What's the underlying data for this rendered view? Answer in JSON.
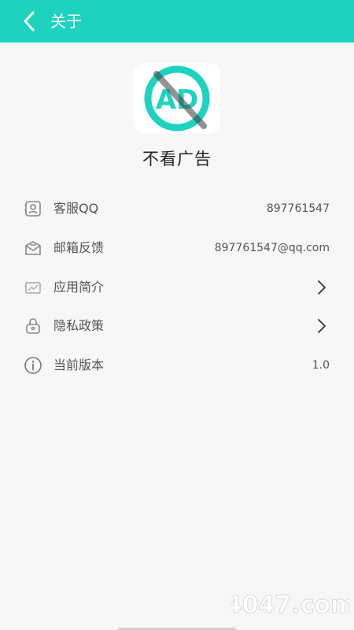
{
  "header": {
    "title": "关于",
    "back_icon": "chevron-left-icon"
  },
  "app": {
    "name": "不看广告",
    "icon_text": "AD",
    "icon_color": "#1dd3c0"
  },
  "rows": [
    {
      "icon": "contact-card-icon",
      "label": "客服QQ",
      "value": "897761547"
    },
    {
      "icon": "mail-icon",
      "label": "邮箱反馈",
      "value": "897761547@qq.com"
    },
    {
      "icon": "app-intro-icon",
      "label": "应用简介",
      "value": ""
    },
    {
      "icon": "privacy-lock-icon",
      "label": "隐私政策",
      "value": ""
    },
    {
      "icon": "info-icon",
      "label": "当前版本",
      "value": "1.0"
    }
  ],
  "colors": {
    "accent": "#1dd3c0",
    "background": "#f7f7f7",
    "text": "#555555"
  },
  "watermark": {
    "text": "4047.com"
  }
}
